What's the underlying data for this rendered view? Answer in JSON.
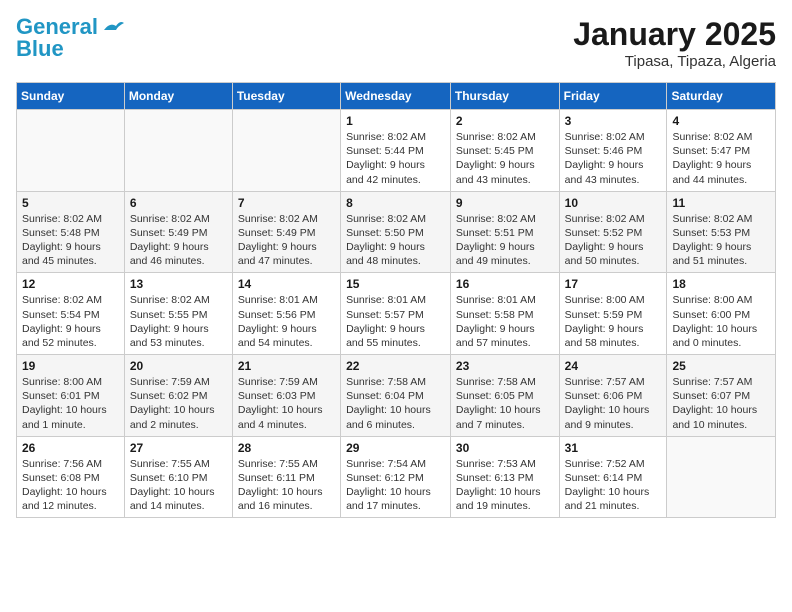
{
  "logo": {
    "line1": "General",
    "line2": "Blue"
  },
  "title": "January 2025",
  "subtitle": "Tipasa, Tipaza, Algeria",
  "weekdays": [
    "Sunday",
    "Monday",
    "Tuesday",
    "Wednesday",
    "Thursday",
    "Friday",
    "Saturday"
  ],
  "weeks": [
    [
      {
        "day": "",
        "info": ""
      },
      {
        "day": "",
        "info": ""
      },
      {
        "day": "",
        "info": ""
      },
      {
        "day": "1",
        "info": "Sunrise: 8:02 AM\nSunset: 5:44 PM\nDaylight: 9 hours and 42 minutes."
      },
      {
        "day": "2",
        "info": "Sunrise: 8:02 AM\nSunset: 5:45 PM\nDaylight: 9 hours and 43 minutes."
      },
      {
        "day": "3",
        "info": "Sunrise: 8:02 AM\nSunset: 5:46 PM\nDaylight: 9 hours and 43 minutes."
      },
      {
        "day": "4",
        "info": "Sunrise: 8:02 AM\nSunset: 5:47 PM\nDaylight: 9 hours and 44 minutes."
      }
    ],
    [
      {
        "day": "5",
        "info": "Sunrise: 8:02 AM\nSunset: 5:48 PM\nDaylight: 9 hours and 45 minutes."
      },
      {
        "day": "6",
        "info": "Sunrise: 8:02 AM\nSunset: 5:49 PM\nDaylight: 9 hours and 46 minutes."
      },
      {
        "day": "7",
        "info": "Sunrise: 8:02 AM\nSunset: 5:49 PM\nDaylight: 9 hours and 47 minutes."
      },
      {
        "day": "8",
        "info": "Sunrise: 8:02 AM\nSunset: 5:50 PM\nDaylight: 9 hours and 48 minutes."
      },
      {
        "day": "9",
        "info": "Sunrise: 8:02 AM\nSunset: 5:51 PM\nDaylight: 9 hours and 49 minutes."
      },
      {
        "day": "10",
        "info": "Sunrise: 8:02 AM\nSunset: 5:52 PM\nDaylight: 9 hours and 50 minutes."
      },
      {
        "day": "11",
        "info": "Sunrise: 8:02 AM\nSunset: 5:53 PM\nDaylight: 9 hours and 51 minutes."
      }
    ],
    [
      {
        "day": "12",
        "info": "Sunrise: 8:02 AM\nSunset: 5:54 PM\nDaylight: 9 hours and 52 minutes."
      },
      {
        "day": "13",
        "info": "Sunrise: 8:02 AM\nSunset: 5:55 PM\nDaylight: 9 hours and 53 minutes."
      },
      {
        "day": "14",
        "info": "Sunrise: 8:01 AM\nSunset: 5:56 PM\nDaylight: 9 hours and 54 minutes."
      },
      {
        "day": "15",
        "info": "Sunrise: 8:01 AM\nSunset: 5:57 PM\nDaylight: 9 hours and 55 minutes."
      },
      {
        "day": "16",
        "info": "Sunrise: 8:01 AM\nSunset: 5:58 PM\nDaylight: 9 hours and 57 minutes."
      },
      {
        "day": "17",
        "info": "Sunrise: 8:00 AM\nSunset: 5:59 PM\nDaylight: 9 hours and 58 minutes."
      },
      {
        "day": "18",
        "info": "Sunrise: 8:00 AM\nSunset: 6:00 PM\nDaylight: 10 hours and 0 minutes."
      }
    ],
    [
      {
        "day": "19",
        "info": "Sunrise: 8:00 AM\nSunset: 6:01 PM\nDaylight: 10 hours and 1 minute."
      },
      {
        "day": "20",
        "info": "Sunrise: 7:59 AM\nSunset: 6:02 PM\nDaylight: 10 hours and 2 minutes."
      },
      {
        "day": "21",
        "info": "Sunrise: 7:59 AM\nSunset: 6:03 PM\nDaylight: 10 hours and 4 minutes."
      },
      {
        "day": "22",
        "info": "Sunrise: 7:58 AM\nSunset: 6:04 PM\nDaylight: 10 hours and 6 minutes."
      },
      {
        "day": "23",
        "info": "Sunrise: 7:58 AM\nSunset: 6:05 PM\nDaylight: 10 hours and 7 minutes."
      },
      {
        "day": "24",
        "info": "Sunrise: 7:57 AM\nSunset: 6:06 PM\nDaylight: 10 hours and 9 minutes."
      },
      {
        "day": "25",
        "info": "Sunrise: 7:57 AM\nSunset: 6:07 PM\nDaylight: 10 hours and 10 minutes."
      }
    ],
    [
      {
        "day": "26",
        "info": "Sunrise: 7:56 AM\nSunset: 6:08 PM\nDaylight: 10 hours and 12 minutes."
      },
      {
        "day": "27",
        "info": "Sunrise: 7:55 AM\nSunset: 6:10 PM\nDaylight: 10 hours and 14 minutes."
      },
      {
        "day": "28",
        "info": "Sunrise: 7:55 AM\nSunset: 6:11 PM\nDaylight: 10 hours and 16 minutes."
      },
      {
        "day": "29",
        "info": "Sunrise: 7:54 AM\nSunset: 6:12 PM\nDaylight: 10 hours and 17 minutes."
      },
      {
        "day": "30",
        "info": "Sunrise: 7:53 AM\nSunset: 6:13 PM\nDaylight: 10 hours and 19 minutes."
      },
      {
        "day": "31",
        "info": "Sunrise: 7:52 AM\nSunset: 6:14 PM\nDaylight: 10 hours and 21 minutes."
      },
      {
        "day": "",
        "info": ""
      }
    ]
  ]
}
